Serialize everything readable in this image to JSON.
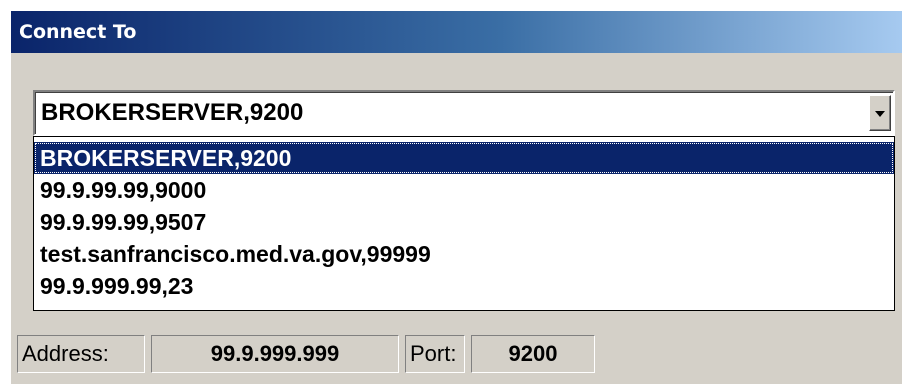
{
  "window": {
    "title": "Connect To"
  },
  "server_combo": {
    "value": "BROKERSERVER,9200",
    "options": [
      "BROKERSERVER,9200",
      "99.9.99.99,9000",
      "99.9.99.99,9507",
      "test.sanfrancisco.med.va.gov,99999",
      "99.9.999.99,23"
    ],
    "selected_index": 0
  },
  "status_bar": {
    "address_label": "Address:",
    "address_value": "99.9.999.999",
    "port_label": "Port:",
    "port_value": "9200"
  },
  "icons": {
    "dropdown": "chevron-down-icon"
  }
}
